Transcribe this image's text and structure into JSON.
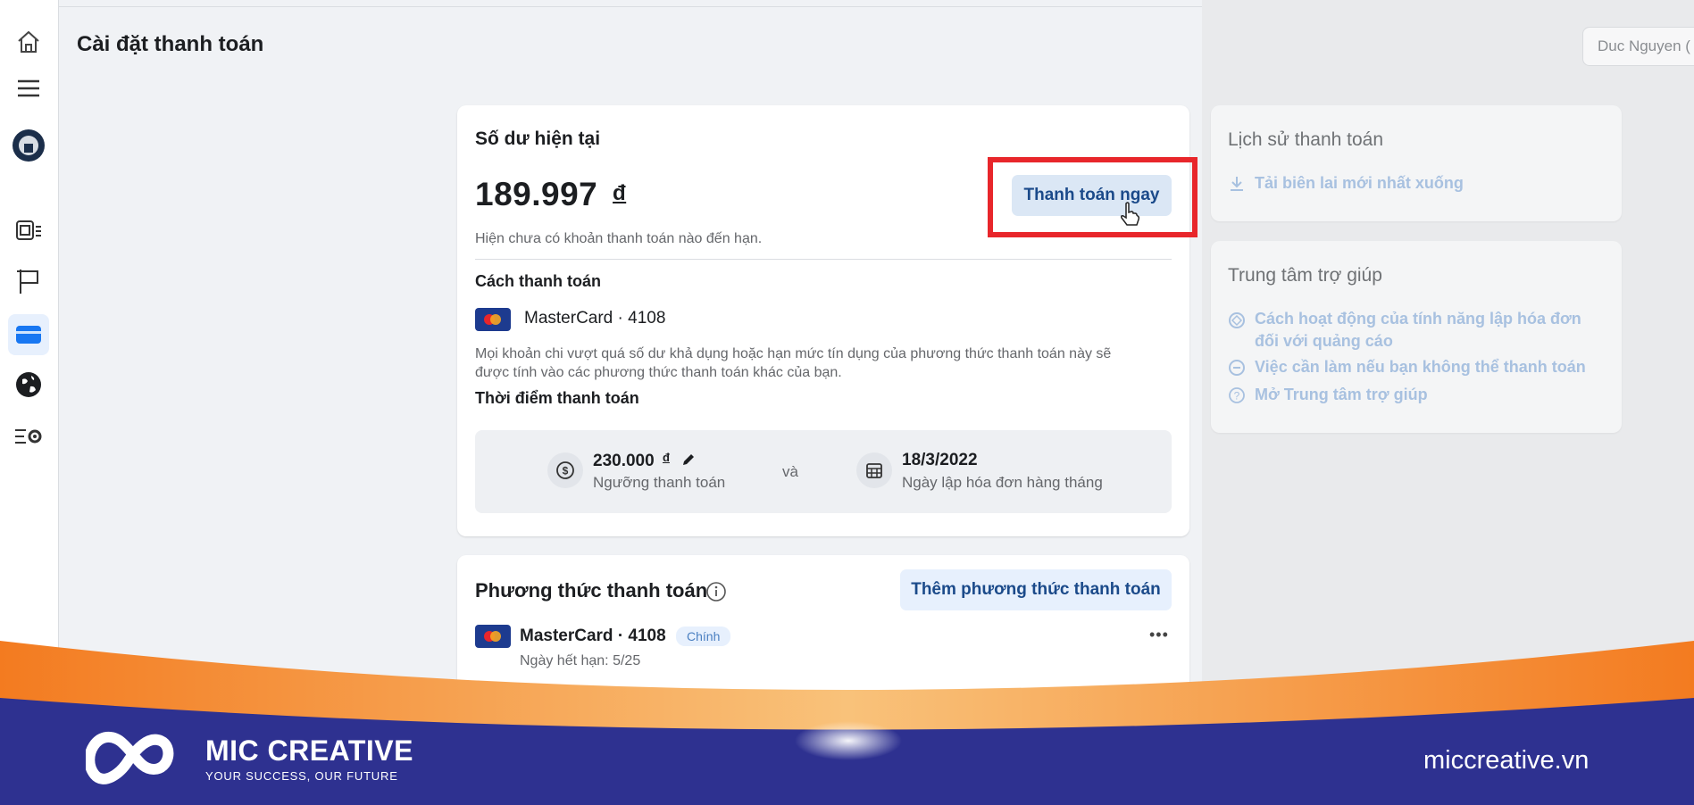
{
  "page": {
    "title": "Cài đặt thanh toán",
    "account": "Duc Nguyen ("
  },
  "sidebar": {
    "items": [
      {
        "icon": "home-icon"
      },
      {
        "icon": "menu-icon"
      },
      {
        "icon": "profile-avatar-icon"
      },
      {
        "icon": "campaigns-icon"
      },
      {
        "icon": "flag-icon"
      },
      {
        "icon": "credit-card-icon",
        "active": true
      },
      {
        "icon": "globe-icon"
      },
      {
        "icon": "settings-list-icon"
      }
    ]
  },
  "balance_card": {
    "heading": "Số dư hiện tại",
    "amount": "189.997",
    "currency": "đ",
    "pay_now": "Thanh toán ngay",
    "no_due_note": "Hiện chưa có khoản thanh toán nào đến hạn.",
    "method_heading": "Cách thanh toán",
    "method_card": "MasterCard · 4108",
    "overflow_note_line1": "Mọi khoản chi vượt quá số dư khả dụng hoặc hạn mức tín dụng của phương thức thanh toán này sẽ",
    "overflow_note_line2": "được tính vào các phương thức thanh toán khác của bạn.",
    "timing_heading": "Thời điểm thanh toán",
    "threshold_value": "230.000",
    "threshold_currency": "đ",
    "threshold_label": "Ngưỡng thanh toán",
    "and_word": "và",
    "billing_date": "18/3/2022",
    "billing_label": "Ngày lập hóa đơn hàng tháng"
  },
  "methods_card": {
    "heading": "Phương thức thanh toán",
    "add_button": "Thêm phương thức thanh toán",
    "card_name": "MasterCard · 4108",
    "badge": "Chính",
    "expiry": "Ngày hết hạn: 5/25",
    "more": "•••"
  },
  "history_card": {
    "heading": "Lịch sử thanh toán",
    "download_link": "Tải biên lai mới nhất xuống"
  },
  "help_card": {
    "heading": "Trung tâm trợ giúp",
    "links": [
      {
        "line1": "Cách hoạt động của tính năng lập hóa đơn",
        "line2": "đối với quảng cáo"
      },
      {
        "line1": "Việc cần làm nếu bạn không thể thanh toán"
      },
      {
        "line1": "Mở Trung tâm trợ giúp"
      }
    ]
  },
  "footer": {
    "brand": "MIC CREATIVE",
    "tagline": "YOUR SUCCESS, OUR FUTURE",
    "website": "miccreative.vn"
  },
  "colors": {
    "highlight": "#e8262b",
    "footer_navy": "#2e3190",
    "footer_orange": "#f08a1c",
    "button_text": "#1b4a8a"
  }
}
